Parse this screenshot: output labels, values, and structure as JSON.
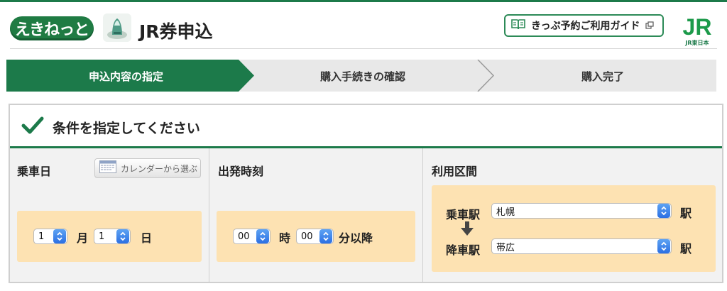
{
  "header": {
    "logo": "えきねっと",
    "title": "JR券申込",
    "guide_label": "きっぷ予約ご利用ガイド",
    "jr_logo": "JR",
    "jr_sub": "JR東日本"
  },
  "steps": [
    {
      "label": "申込内容の指定",
      "active": true
    },
    {
      "label": "購入手続きの確認",
      "active": false
    },
    {
      "label": "購入完了",
      "active": false
    }
  ],
  "panel": {
    "title": "条件を指定してください",
    "date": {
      "label": "乗車日",
      "calendar_button": "カレンダーから選ぶ",
      "month_value": "1",
      "month_unit": "月",
      "day_value": "1",
      "day_unit": "日"
    },
    "time": {
      "label": "出発時刻",
      "hour_value": "00",
      "hour_unit": "時",
      "minute_value": "00",
      "minute_unit": "分以降"
    },
    "route": {
      "label": "利用区間",
      "from_label": "乗車駅",
      "from_value": "札幌",
      "to_label": "降車駅",
      "to_value": "帯広",
      "station_suffix": "駅"
    }
  },
  "colors": {
    "brand_green": "#1c7a4a",
    "step_inactive": "#e8e8e8",
    "input_bg": "#fde2b2",
    "select_arrow": "#2b6fe3"
  }
}
